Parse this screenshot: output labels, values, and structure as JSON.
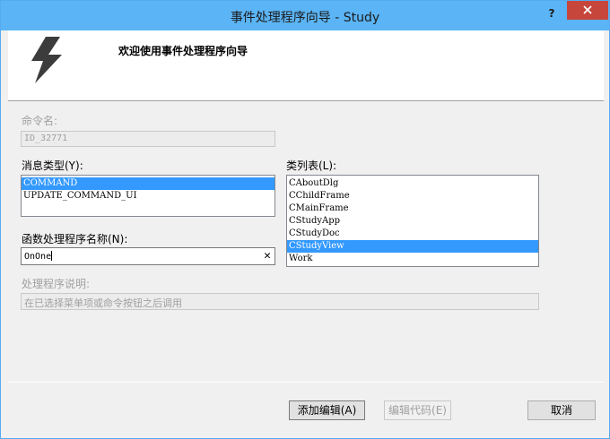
{
  "window": {
    "title": "事件处理程序向导 - Study",
    "help_label": "?"
  },
  "banner": {
    "heading": "欢迎使用事件处理程序向导",
    "icon": "lightning-bolt-icon"
  },
  "command_name": {
    "label": "命令名:",
    "value": "ID_32771"
  },
  "message_type": {
    "label": "消息类型(Y):",
    "items": [
      "COMMAND",
      "UPDATE_COMMAND_UI"
    ],
    "selected": "COMMAND"
  },
  "class_list": {
    "label": "类列表(L):",
    "items": [
      "CAboutDlg",
      "CChildFrame",
      "CMainFrame",
      "CStudyApp",
      "CStudyDoc",
      "CStudyView",
      "Work"
    ],
    "selected": "CStudyView"
  },
  "handler_name": {
    "label": "函数处理程序名称(N):",
    "value": "OnOne"
  },
  "handler_desc": {
    "label": "处理程序说明:",
    "value": "在已选择菜单项或命令按钮之后调用"
  },
  "buttons": {
    "add_edit": "添加编辑(A)",
    "edit_code": "编辑代码(E)",
    "cancel": "取消"
  },
  "colors": {
    "titlebar": "#5bb4f5",
    "selection": "#3399ff",
    "close": "#c7463c"
  }
}
